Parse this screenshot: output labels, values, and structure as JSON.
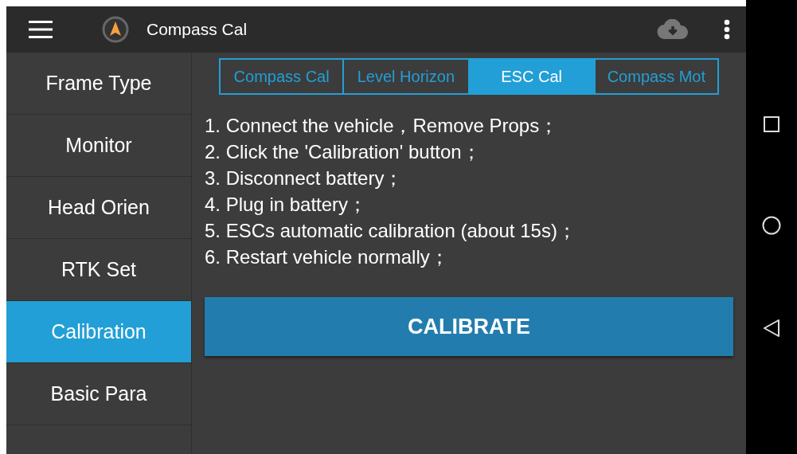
{
  "app_bar": {
    "title": "Compass Cal"
  },
  "sidebar": {
    "items": [
      {
        "label": "Frame Type",
        "selected": false
      },
      {
        "label": "Monitor",
        "selected": false
      },
      {
        "label": "Head Orien",
        "selected": false
      },
      {
        "label": "RTK Set",
        "selected": false
      },
      {
        "label": "Calibration",
        "selected": true
      },
      {
        "label": "Basic Para",
        "selected": false
      }
    ]
  },
  "tabs": [
    {
      "label": "Compass Cal",
      "selected": false
    },
    {
      "label": "Level Horizon",
      "selected": false
    },
    {
      "label": "ESC Cal",
      "selected": true
    },
    {
      "label": "Compass Mot",
      "selected": false
    }
  ],
  "instructions": [
    "1. Connect the vehicle，Remove Props；",
    "2. Click the 'Calibration' button；",
    "3. Disconnect battery；",
    "4. Plug in battery；",
    "5. ESCs automatic calibration (about 15s)；",
    "6. Restart vehicle normally；"
  ],
  "calibrate_button": "CALIBRATE"
}
